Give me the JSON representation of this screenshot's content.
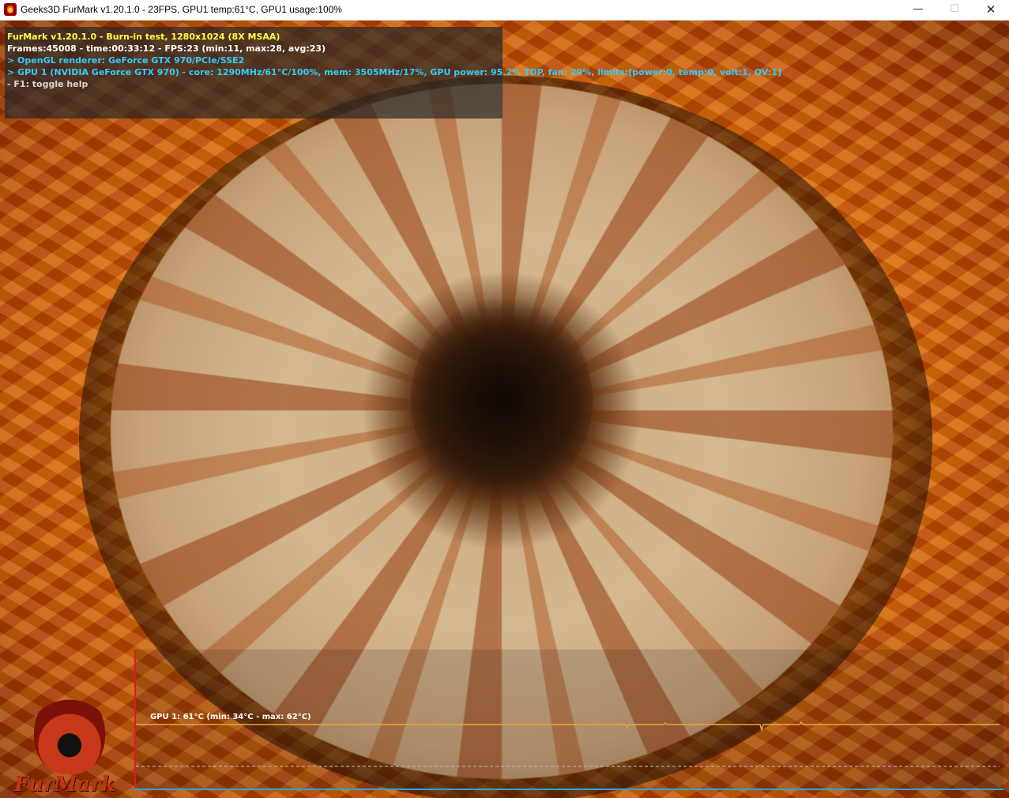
{
  "window": {
    "title": "Geeks3D FurMark v1.20.1.0 - 23FPS, GPU1 temp:61°C, GPU1 usage:100%",
    "minimize_glyph": "—",
    "maximize_glyph": "☐",
    "close_glyph": "✕"
  },
  "osd": {
    "line1": "FurMark v1.20.1.0 - Burn-in test, 1280x1024 (8X MSAA)",
    "line2": "Frames:45008 - time:00:33:12 - FPS:23 (min:11, max:28, avg:23)",
    "line3": "> OpenGL renderer: GeForce GTX 970/PCIe/SSE2",
    "line4": "> GPU 1 (NVIDIA GeForce GTX 970) - core: 1290MHz/61°C/100%, mem: 3505MHz/17%, GPU power: 95.2% TDP, fan: 29%, limits:[power:0, temp:0, volt:1, OV:1]",
    "line5": "- F1: toggle help"
  },
  "graph": {
    "label": "GPU 1: 61°C (min: 34°C - max: 62°C)",
    "line_color": "#f2a33a",
    "axis_color": "#2aa7d6",
    "y_axis_color": "#d81f1f"
  },
  "logo": {
    "text": "FurMark"
  },
  "icons": {
    "app": "furmark-flame-icon"
  }
}
